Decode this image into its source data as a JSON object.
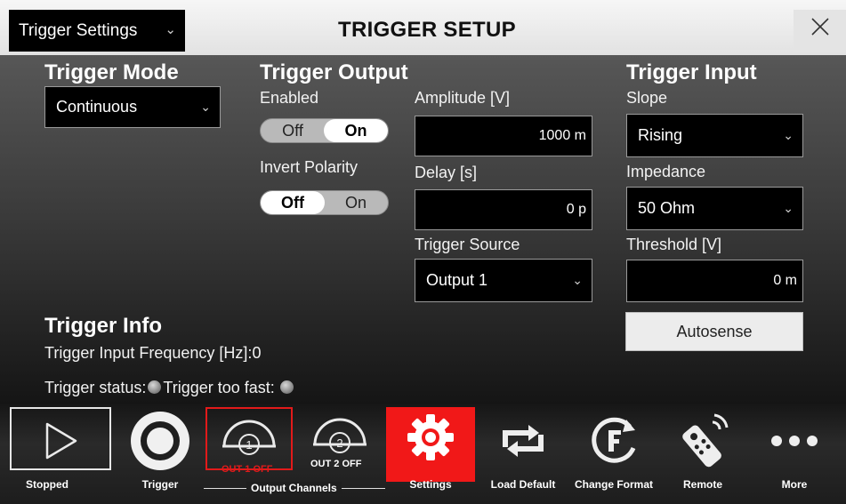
{
  "titlebar": {
    "menu_value": "Trigger Settings",
    "title": "TRIGGER SETUP",
    "close_icon": "close-icon"
  },
  "trigger_mode": {
    "heading": "Trigger Mode",
    "value": "Continuous"
  },
  "trigger_output": {
    "heading": "Trigger Output",
    "enabled_label": "Enabled",
    "enabled_off": "Off",
    "enabled_on": "On",
    "enabled_state": "On",
    "invert_label": "Invert Polarity",
    "invert_off": "Off",
    "invert_on": "On",
    "invert_state": "Off",
    "amplitude_label": "Amplitude [V]",
    "amplitude_value": "1000 m",
    "delay_label": "Delay [s]",
    "delay_value": "0 p",
    "source_label": "Trigger Source",
    "source_value": "Output 1"
  },
  "trigger_input": {
    "heading": "Trigger Input",
    "slope_label": "Slope",
    "slope_value": "Rising",
    "impedance_label": "Impedance",
    "impedance_value": "50 Ohm",
    "threshold_label": "Threshold [V]",
    "threshold_value": "0 m",
    "autosense_label": "Autosense"
  },
  "trigger_info": {
    "heading": "Trigger Info",
    "frequency_label": "Trigger Input Frequency  [Hz]:",
    "frequency_value": "0",
    "status_label": "Trigger status:",
    "too_fast_label": "Trigger too fast:"
  },
  "toolbar": {
    "stopped": "Stopped",
    "trigger": "Trigger",
    "out1_sub": "OUT 1 OFF",
    "out2_sub": "OUT 2 OFF",
    "out1_num": "1",
    "out2_num": "2",
    "channels": "Output Channels",
    "settings": "Settings",
    "load_default": "Load Default",
    "change_format": "Change Format",
    "remote": "Remote",
    "more": "More"
  },
  "colors": {
    "accent_red": "#f11818",
    "panel_top": "#575757",
    "panel_bottom": "#151515"
  }
}
